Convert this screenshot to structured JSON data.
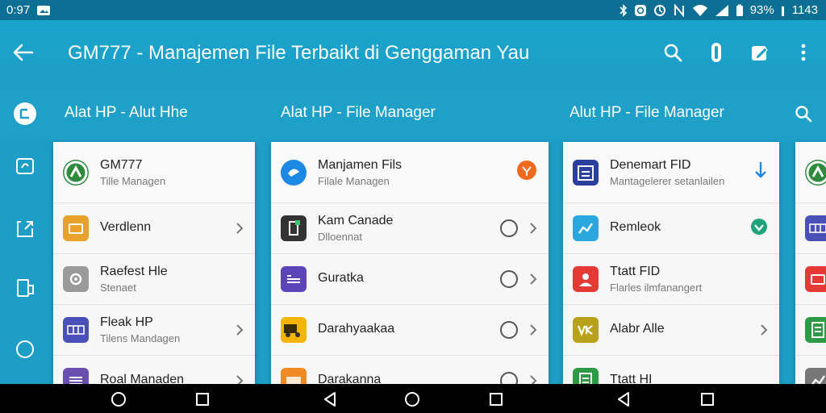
{
  "status_bar": {
    "time": "0:97",
    "battery": "93%",
    "clock_right": "1143",
    "icons": [
      "image-icon",
      "bluetooth-icon",
      "alarm-icon",
      "sync-icon",
      "nfc-icon",
      "wifi-icon",
      "signal-icon",
      "battery-icon"
    ]
  },
  "app_bar": {
    "title": "GM777 - Manajemen File Terbaikt di Genggaman Yau",
    "actions": [
      "search-icon",
      "clip-icon",
      "edit-icon",
      "overflow-menu-icon"
    ]
  },
  "tabs": [
    {
      "label": "Alat HP - Alut Hhe"
    },
    {
      "label": "Alat HP - File Manager"
    },
    {
      "label": "Alut HP - File Manager"
    }
  ],
  "rail": {
    "items": [
      "folder-icon",
      "storage-icon",
      "share-icon",
      "device-icon",
      "circle-icon"
    ]
  },
  "panels": [
    {
      "rows": [
        {
          "title": "GM777",
          "subtitle": "Tille Managen",
          "icon": "gm777-logo-icon",
          "color": "#2e8b3e",
          "end": ""
        },
        {
          "title": "Verdlenn",
          "subtitle": "",
          "icon": "folder-icon",
          "color": "#e8a22a",
          "end": "chevron"
        },
        {
          "title": "Raefest Hle",
          "subtitle": "Stenaet",
          "icon": "settings-file-icon",
          "color": "#9a9a9a",
          "end": ""
        },
        {
          "title": "Fleak HP",
          "subtitle": "Tilens Mandagen",
          "icon": "grid-icon",
          "color": "#4b4fb8",
          "end": "chevron"
        },
        {
          "title": "Roal Manaden",
          "subtitle": "",
          "icon": "list-icon",
          "color": "#6a4fb0",
          "end": "chevron"
        }
      ]
    },
    {
      "rows": [
        {
          "title": "Manjamen Fils",
          "subtitle": "Filale Managen",
          "icon": "cloud-icon",
          "color": "#1e88e5",
          "end": "badge"
        },
        {
          "title": "Kam Canade",
          "subtitle": "Dlloennat",
          "icon": "document-icon",
          "color": "#333333",
          "end": "radio"
        },
        {
          "title": "Guratka",
          "subtitle": "",
          "icon": "storage-card-icon",
          "color": "#5b45b8",
          "end": "radio"
        },
        {
          "title": "Darahyaakaa",
          "subtitle": "",
          "icon": "truck-icon",
          "color": "#f4b400",
          "end": "radio"
        },
        {
          "title": "Darakanna",
          "subtitle": "",
          "icon": "box-icon",
          "color": "#f08a24",
          "end": "radio"
        }
      ]
    },
    {
      "rows": [
        {
          "title": "Denemart FID",
          "subtitle": "Mantagelerer setanlailen",
          "icon": "calendar-icon",
          "color": "#2c3e9e",
          "end": "download"
        },
        {
          "title": "Remleok",
          "subtitle": "",
          "icon": "chart-icon",
          "color": "#29a8e0",
          "end": "heart"
        },
        {
          "title": "Ttatt FID",
          "subtitle": "Flarles ilmfanangert",
          "icon": "people-icon",
          "color": "#e53935",
          "end": ""
        },
        {
          "title": "Alabr Alle",
          "subtitle": "",
          "icon": "vk-icon",
          "color": "#b8a21a",
          "end": "chevron"
        },
        {
          "title": "Ttatt HI",
          "subtitle": "",
          "icon": "sheet-icon",
          "color": "#2e9a46",
          "end": ""
        }
      ]
    },
    {
      "rows": [
        {
          "title": "",
          "subtitle": "",
          "icon": "gm777-logo-icon",
          "color": "#2e8b3e",
          "end": ""
        },
        {
          "title": "",
          "subtitle": "",
          "icon": "grid-icon",
          "color": "#4b4fb8",
          "end": ""
        },
        {
          "title": "",
          "subtitle": "",
          "icon": "folder-icon",
          "color": "#e53935",
          "end": ""
        },
        {
          "title": "",
          "subtitle": "",
          "icon": "sheet-icon",
          "color": "#2e9a46",
          "end": ""
        },
        {
          "title": "",
          "subtitle": "",
          "icon": "chart-icon",
          "color": "#777777",
          "end": ""
        }
      ]
    }
  ],
  "nav_bar": {
    "buttons": [
      "home-icon",
      "recents-icon",
      "back-icon",
      "home-icon",
      "recents-icon",
      "back-icon",
      "recents-icon"
    ]
  },
  "colors": {
    "accent": "#1ea0c9",
    "status_bar": "#0d6f93",
    "badge_orange": "#ef6a1e",
    "badge_green": "#1fa37a",
    "download_blue": "#1e88e5"
  }
}
